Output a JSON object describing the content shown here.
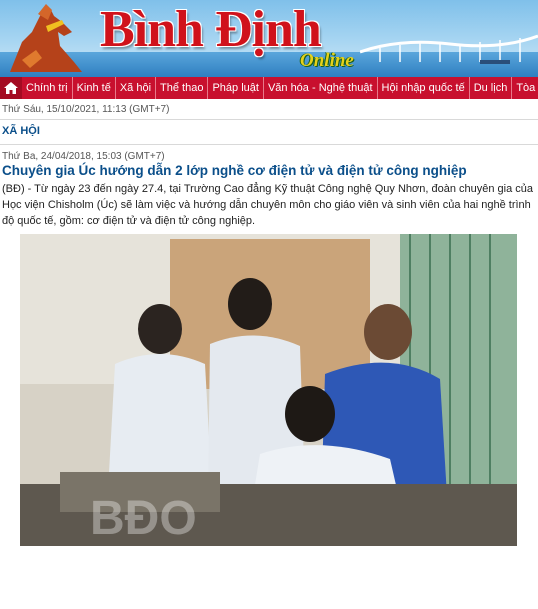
{
  "header": {
    "brand": "Bình Định",
    "brand_sub": "Online"
  },
  "nav": {
    "items": [
      "Chính trị",
      "Kinh tế",
      "Xã hội",
      "Thể thao",
      "Pháp luật",
      "Văn hóa - Nghệ thuật",
      "Hội nhập quốc tế",
      "Du lịch",
      "Tòa soạn - Bạn đọc"
    ]
  },
  "current_date": "Thứ Sáu, 15/10/2021, 11:13 (GMT+7)",
  "section_label": "XÃ HỘI",
  "article": {
    "published": "Thứ Ba, 24/04/2018, 15:03 (GMT+7)",
    "title": "Chuyên gia Úc hướng dẫn 2 lớp nghề cơ điện tử và điện tử công nghiệp",
    "summary_line1": "(BĐ) - Từ ngày 23 đến ngày 27.4, tại Trường Cao đẳng Kỹ thuật Công nghệ Quy Nhơn, đoàn chuyên gia của",
    "summary_line2": "Học viện Chisholm (Úc) sẽ làm việc và hướng dẫn chuyên môn cho giáo viên và sinh viên của hai nghề trình",
    "summary_line3": "độ quốc tế, gồm: cơ điện tử và điện tử công nghiệp.",
    "photo_watermark": "BĐO"
  },
  "colors": {
    "nav_bg": "#c8102e",
    "headline": "#0b4f8a",
    "brand_red": "#d0121b"
  },
  "icons": [
    "home-icon"
  ]
}
